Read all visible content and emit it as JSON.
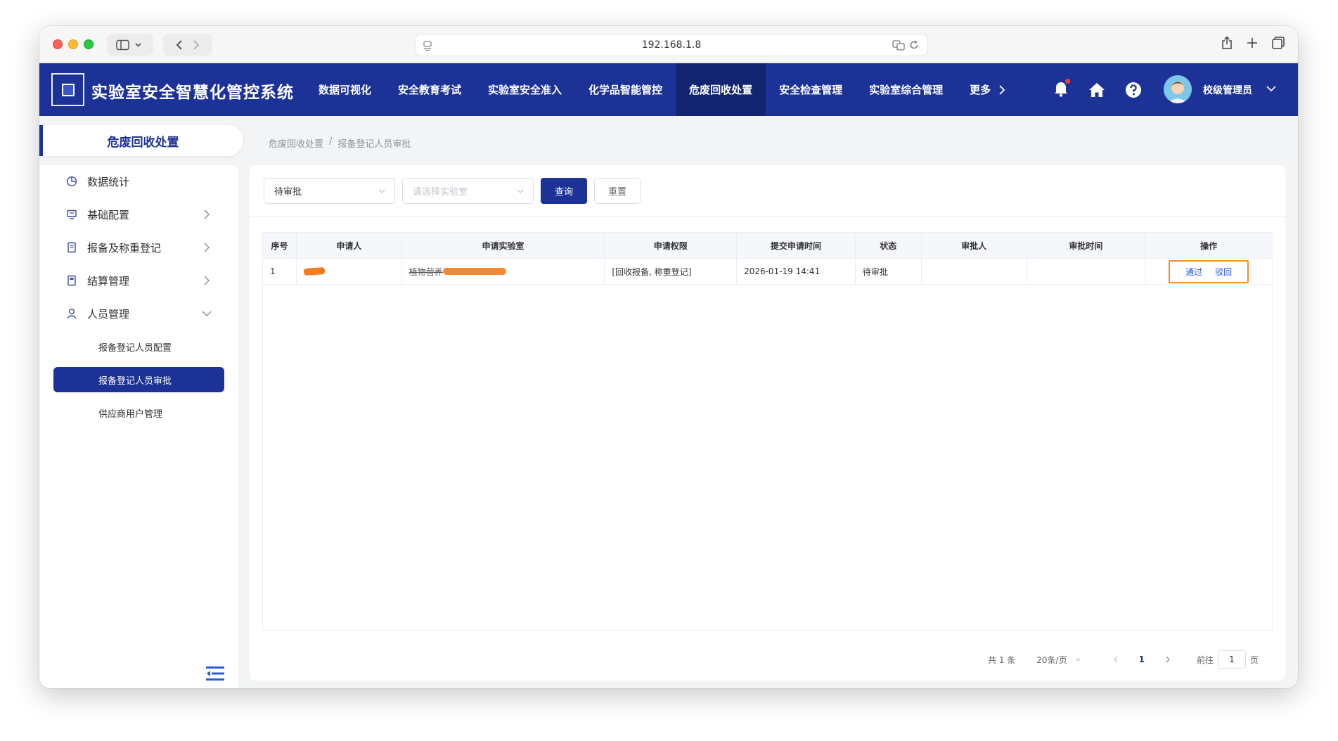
{
  "browser": {
    "url": "192.168.1.8"
  },
  "app": {
    "title": "实验室安全智慧化管控系统",
    "nav": [
      {
        "label": "数据可视化"
      },
      {
        "label": "安全教育考试"
      },
      {
        "label": "实验室安全准入"
      },
      {
        "label": "化学品智能管控"
      },
      {
        "label": "危废回收处置",
        "active": true
      },
      {
        "label": "安全检查管理"
      },
      {
        "label": "实验室综合管理"
      },
      {
        "label": "更多"
      }
    ],
    "user_name": "校级管理员"
  },
  "sidebar": {
    "section_title": "危废回收处置",
    "items": [
      {
        "label": "数据统计",
        "icon": "chart-pie-icon"
      },
      {
        "label": "基础配置",
        "icon": "monitor-icon"
      },
      {
        "label": "报备及称重登记",
        "icon": "document-icon"
      },
      {
        "label": "结算管理",
        "icon": "calculator-icon"
      },
      {
        "label": "人员管理",
        "icon": "user-icon"
      }
    ],
    "sub_items": [
      {
        "label": "报备登记人员配置"
      },
      {
        "label": "报备登记人员审批",
        "active": true
      },
      {
        "label": "供应商用户管理"
      }
    ]
  },
  "breadcrumb": {
    "root": "危废回收处置",
    "separator": "/",
    "current": "报备登记人员审批"
  },
  "filters": {
    "status_value": "待审批",
    "lab_placeholder": "请选择实验室",
    "query_label": "查询",
    "reset_label": "重置"
  },
  "table": {
    "headers": [
      "序号",
      "申请人",
      "申请实验室",
      "申请权限",
      "提交申请时间",
      "状态",
      "审批人",
      "审批时间",
      "操作"
    ],
    "rows": [
      {
        "index": "1",
        "lab": "植物营养",
        "permission": "[回收报备, 称重登记]",
        "submitted": "2026-01-19 14:41",
        "status": "待审批",
        "approver": "",
        "approved_time": "",
        "approve_label": "通过",
        "reject_label": "驳回"
      }
    ]
  },
  "pagination": {
    "total": "共 1 条",
    "page_size": "20条/页",
    "current_page": "1",
    "goto_label": "前往",
    "goto_value": "1",
    "page_unit": "页"
  },
  "colors": {
    "primary": "#1d3296",
    "highlight": "#f28c28",
    "link": "#2a5bdb"
  }
}
